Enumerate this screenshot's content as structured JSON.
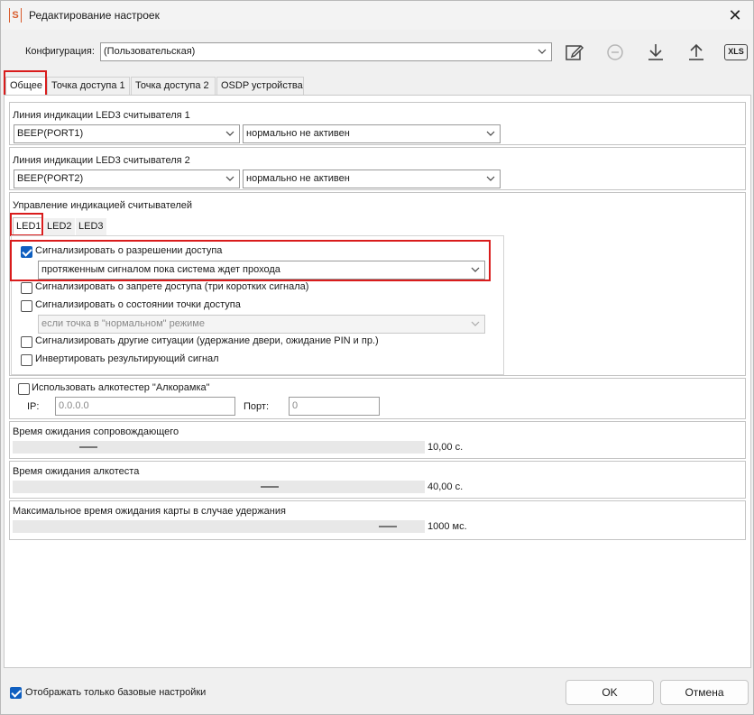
{
  "window": {
    "title": "Редактирование настроек",
    "app_icon": "S",
    "close_glyph": "✕"
  },
  "config": {
    "label": "Конфигурация:",
    "value": "(Пользовательская)"
  },
  "toolbar": {
    "edit_icon": "edit-icon",
    "remove_icon": "minus-circle-icon",
    "download_icon": "download-icon",
    "upload_icon": "upload-icon",
    "xls_label": "XLS"
  },
  "tabs": [
    "Общее",
    "Точка доступа 1",
    "Точка доступа 2",
    "OSDP устройства"
  ],
  "led_line_1": {
    "label": "Линия индикации LED3 считывателя 1",
    "port": "BEEP(PORT1)",
    "mode": "нормально не активен"
  },
  "led_line_2": {
    "label": "Линия индикации LED3 считывателя 2",
    "port": "BEEP(PORT2)",
    "mode": "нормально не активен"
  },
  "indication": {
    "label": "Управление индикацией считывателей",
    "tabs": [
      "LED1",
      "LED2",
      "LED3"
    ],
    "access_granted": {
      "label": "Сигнализировать о разрешении доступа",
      "checked": true,
      "mode": "протяженным сигналом пока система ждет прохода"
    },
    "access_denied": {
      "label": "Сигнализировать о запрете доступа (три коротких сигнала)",
      "checked": false
    },
    "point_state": {
      "label": "Сигнализировать о состоянии точки доступа",
      "checked": false,
      "mode": "если точка в \"нормальном\" режиме"
    },
    "other": {
      "label": "Сигнализировать другие ситуации (удержание двери, ожидание PIN и пр.)",
      "checked": false
    },
    "invert": {
      "label": "Инвертировать результирующий сигнал",
      "checked": false
    }
  },
  "alcotester": {
    "label": "Использовать алкотестер \"Алкорамка\"",
    "checked": false,
    "ip_label": "IP:",
    "ip_placeholder": "0.0.0.0",
    "port_label": "Порт:",
    "port_placeholder": "0"
  },
  "escort_wait": {
    "label": "Время ожидания сопровождающего",
    "value": "10,00 с.",
    "level": 0.17
  },
  "alco_wait": {
    "label": "Время ожидания алкотеста",
    "value": "40,00 с.",
    "level": 0.63
  },
  "card_wait": {
    "label": "Максимальное время ожидания карты в случае удержания",
    "value": "1000 мс.",
    "level": 0.93
  },
  "footer": {
    "basic_only_label": "Отображать только базовые настройки",
    "basic_only_checked": true,
    "ok_label": "OK",
    "cancel_label": "Отмена"
  },
  "colors": {
    "highlight": "#d91c1c",
    "checkbox_accent": "#0f5fc0"
  }
}
